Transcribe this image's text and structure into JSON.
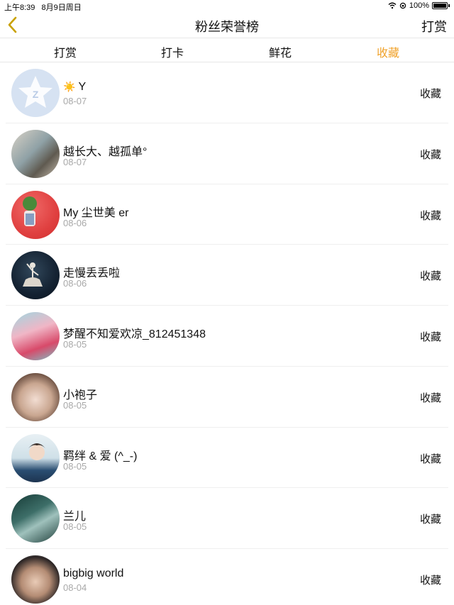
{
  "status": {
    "time": "上午8:39",
    "date": "8月9日周日",
    "battery": "100%"
  },
  "nav": {
    "title": "粉丝荣誉榜",
    "action": "打赏"
  },
  "tabs": [
    {
      "label": "打赏"
    },
    {
      "label": "打卡"
    },
    {
      "label": "鲜花"
    },
    {
      "label": "收藏"
    }
  ],
  "colors": {
    "accent": "#f0a22a"
  },
  "rows": [
    {
      "name": "Y",
      "emoji": "☀️",
      "date": "08-07",
      "type": "收藏"
    },
    {
      "name": "越长大、越孤单°",
      "date": "08-07",
      "type": "收藏"
    },
    {
      "name": "My 尘世美 er",
      "date": "08-06",
      "type": "收藏"
    },
    {
      "name": "走慢丢丢啦",
      "date": "08-06",
      "type": "收藏"
    },
    {
      "name": "梦醒不知爱欢凉_812451348",
      "date": "08-05",
      "type": "收藏"
    },
    {
      "name": "小袍子",
      "date": "08-05",
      "type": "收藏"
    },
    {
      "name": "羁绊 & 爱 (^_-)",
      "date": "08-05",
      "type": "收藏"
    },
    {
      "name": "兰儿",
      "date": "08-05",
      "type": "收藏"
    },
    {
      "name": "bigbig world",
      "date": "08-04",
      "type": "收藏"
    }
  ]
}
